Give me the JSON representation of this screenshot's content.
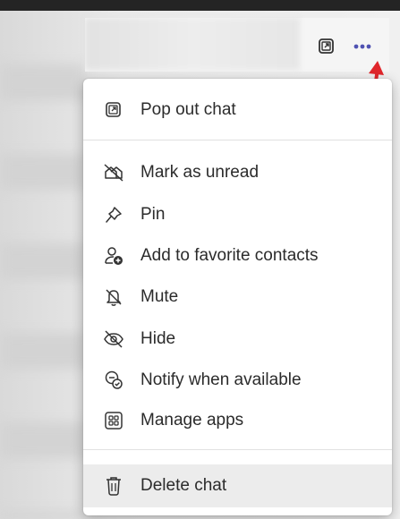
{
  "menu": {
    "items": [
      {
        "label": "Pop out chat",
        "icon": "pop-out-icon"
      },
      {
        "label": "Mark as unread",
        "icon": "mark-unread-icon"
      },
      {
        "label": "Pin",
        "icon": "pin-icon"
      },
      {
        "label": "Add to favorite contacts",
        "icon": "add-contact-icon"
      },
      {
        "label": "Mute",
        "icon": "mute-bell-icon"
      },
      {
        "label": "Hide",
        "icon": "hide-icon"
      },
      {
        "label": "Notify when available",
        "icon": "notify-available-icon"
      },
      {
        "label": "Manage apps",
        "icon": "apps-icon"
      },
      {
        "label": "Delete chat",
        "icon": "trash-icon"
      }
    ]
  },
  "colors": {
    "annotation_arrow": "#e0262b",
    "more_dots": "#4f52b2",
    "menu_text": "#2b2b2b",
    "hover_row": "#ececec"
  }
}
